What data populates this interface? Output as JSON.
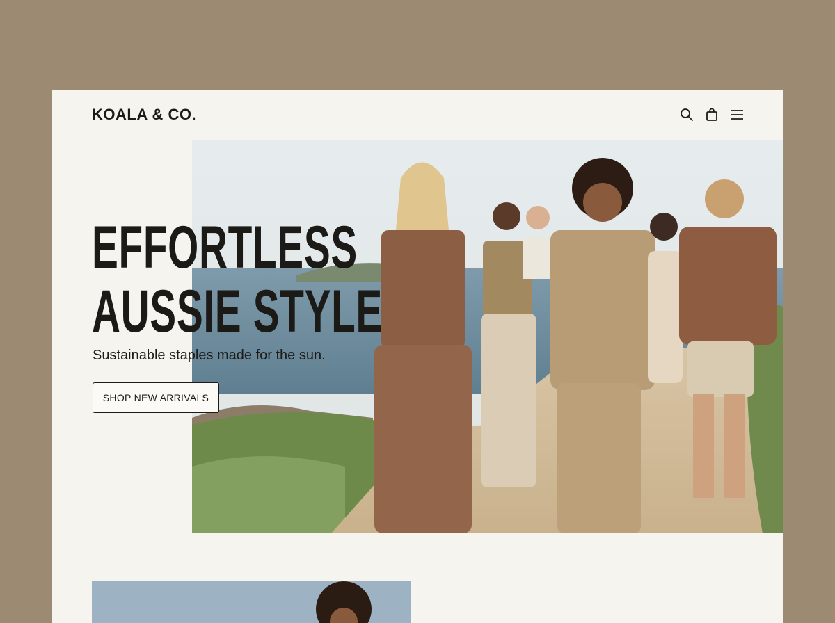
{
  "header": {
    "logo": "KOALA & CO.",
    "icons": [
      "search-icon",
      "shopping-bag-icon",
      "menu-icon"
    ]
  },
  "hero": {
    "headline_line1": "EFFORTLESS",
    "headline_line2": "AUSSIE STYLE",
    "subheading": "Sustainable staples made for the sun.",
    "cta_label": "SHOP NEW ARRIVALS"
  },
  "colors": {
    "outer_background": "#9c8a72",
    "page_background": "#f6f4ee",
    "text": "#1d1b18"
  }
}
